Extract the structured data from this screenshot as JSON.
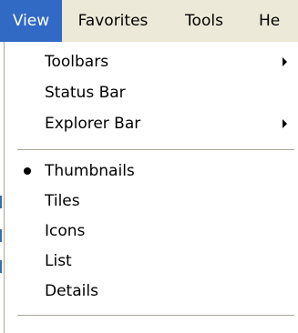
{
  "menubar": {
    "items": [
      {
        "label": "View",
        "active": true
      },
      {
        "label": "Favorites",
        "active": false
      },
      {
        "label": "Tools",
        "active": false
      },
      {
        "label": "He",
        "active": false
      }
    ]
  },
  "view_menu": {
    "group1": [
      {
        "label": "Toolbars",
        "submenu": true
      },
      {
        "label": "Status Bar",
        "submenu": false
      },
      {
        "label": "Explorer Bar",
        "submenu": true
      }
    ],
    "group2": [
      {
        "label": "Thumbnails",
        "selected": true
      },
      {
        "label": "Tiles",
        "selected": false
      },
      {
        "label": "Icons",
        "selected": false
      },
      {
        "label": "List",
        "selected": false
      },
      {
        "label": "Details",
        "selected": false
      }
    ]
  },
  "colors": {
    "highlight": "#316ac5",
    "menubar_bg": "#ece9d8",
    "menu_bg": "#ffffff",
    "separator": "#aca899"
  },
  "icons": {
    "submenu_arrow": "chevron-right-icon",
    "selected_bullet": "radio-bullet-icon"
  }
}
